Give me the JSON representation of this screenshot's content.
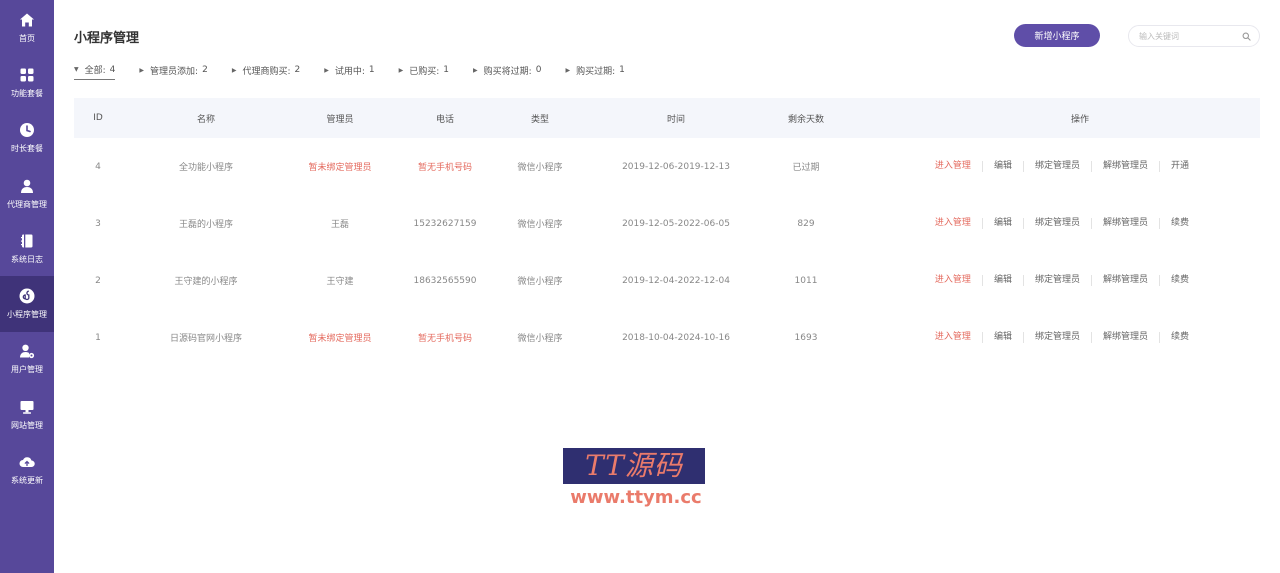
{
  "sidebar": {
    "items": [
      {
        "icon": "home-icon",
        "label": "首页"
      },
      {
        "icon": "grid-icon",
        "label": "功能套餐"
      },
      {
        "icon": "clock-icon",
        "label": "时长套餐"
      },
      {
        "icon": "user-icon",
        "label": "代理商管理"
      },
      {
        "icon": "book-icon",
        "label": "系统日志"
      },
      {
        "icon": "miniprogram-icon",
        "label": "小程序管理"
      },
      {
        "icon": "user-gear-icon",
        "label": "用户管理"
      },
      {
        "icon": "monitor-icon",
        "label": "网站管理"
      },
      {
        "icon": "cloud-upload-icon",
        "label": "系统更新"
      }
    ],
    "active_index": 5
  },
  "header": {
    "title": "小程序管理",
    "add_label": "新增小程序",
    "search_placeholder": "输入关键词"
  },
  "filters": [
    {
      "label": "全部:",
      "count": "4"
    },
    {
      "label": "管理员添加:",
      "count": "2"
    },
    {
      "label": "代理商购买:",
      "count": "2"
    },
    {
      "label": "试用中:",
      "count": "1"
    },
    {
      "label": "已购买:",
      "count": "1"
    },
    {
      "label": "购买将过期:",
      "count": "0"
    },
    {
      "label": "购买过期:",
      "count": "1"
    }
  ],
  "table": {
    "columns": [
      "ID",
      "名称",
      "管理员",
      "电话",
      "类型",
      "时间",
      "剩余天数",
      "操作"
    ],
    "rows": [
      {
        "id": "4",
        "name": "全功能小程序",
        "admin": "暂未绑定管理员",
        "phone": "暂无手机号码",
        "type": "微信小程序",
        "time": "2019-12-06-2019-12-13",
        "days": "已过期",
        "ops": [
          "进入管理",
          "编辑",
          "绑定管理员",
          "解绑管理员",
          "开通"
        ]
      },
      {
        "id": "3",
        "name": "王磊的小程序",
        "admin": "王磊",
        "phone": "15232627159",
        "type": "微信小程序",
        "time": "2019-12-05-2022-06-05",
        "days": "829",
        "ops": [
          "进入管理",
          "编辑",
          "绑定管理员",
          "解绑管理员",
          "续费"
        ]
      },
      {
        "id": "2",
        "name": "王守建的小程序",
        "admin": "王守建",
        "phone": "18632565590",
        "type": "微信小程序",
        "time": "2019-12-04-2022-12-04",
        "days": "1011",
        "ops": [
          "进入管理",
          "编辑",
          "绑定管理员",
          "解绑管理员",
          "续费"
        ]
      },
      {
        "id": "1",
        "name": "日源码官网小程序",
        "admin": "暂未绑定管理员",
        "phone": "暂无手机号码",
        "type": "微信小程序",
        "time": "2018-10-04-2024-10-16",
        "days": "1693",
        "ops": [
          "进入管理",
          "编辑",
          "绑定管理员",
          "解绑管理员",
          "续费"
        ]
      }
    ]
  },
  "watermark": {
    "title": "TT源码",
    "url": "www.ttym.cc"
  },
  "colors": {
    "sidebar": "#57489a",
    "sidebar_active": "#3f3379",
    "accent": "#5f4ea8",
    "warning_text": "#e46a5e"
  }
}
